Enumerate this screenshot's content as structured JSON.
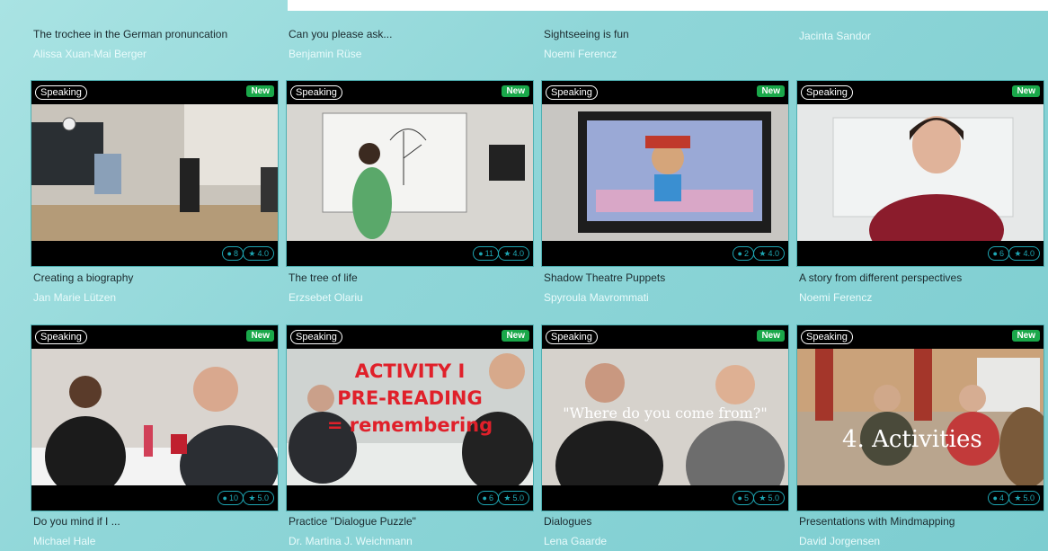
{
  "top_row": [
    {
      "title": "The trochee in the German pronuncation",
      "author": "Alissa Xuan-Mai Berger"
    },
    {
      "title": "Can you please ask...",
      "author": "Benjamin Rüse"
    },
    {
      "title": "Sightseeing is fun",
      "author": "Noemi Ferencz"
    },
    {
      "title": "",
      "author": "Jacinta Sandor"
    }
  ],
  "row1": [
    {
      "tag": "Speaking",
      "badge": "New",
      "comments": "8",
      "rating": "4.0",
      "title": "Creating a biography",
      "author": "Jan Marie Lützen"
    },
    {
      "tag": "Speaking",
      "badge": "New",
      "comments": "11",
      "rating": "4.0",
      "title": "The tree of life",
      "author": "Erzsebet Olariu"
    },
    {
      "tag": "Speaking",
      "badge": "New",
      "comments": "2",
      "rating": "4.0",
      "title": "Shadow Theatre Puppets",
      "author": "Spyroula Mavrommati"
    },
    {
      "tag": "Speaking",
      "badge": "New",
      "comments": "6",
      "rating": "4.0",
      "title": "A story from different perspectives",
      "author": "Noemi Ferencz"
    }
  ],
  "row2": [
    {
      "tag": "Speaking",
      "badge": "New",
      "comments": "10",
      "rating": "5.0",
      "title": "Do you mind if I ...",
      "author": "Michael Hale"
    },
    {
      "tag": "Speaking",
      "badge": "New",
      "comments": "6",
      "rating": "5.0",
      "title": "Practice \"Dialogue Puzzle\"",
      "author": "Dr. Martina J. Weichmann",
      "overlay": [
        "ACTIVITY I",
        "PRE-READING",
        "= remembering"
      ]
    },
    {
      "tag": "Speaking",
      "badge": "New",
      "comments": "5",
      "rating": "5.0",
      "title": "Dialogues",
      "author": "Lena Gaarde",
      "overlay": "\"Where do you come from?\""
    },
    {
      "tag": "Speaking",
      "badge": "New",
      "comments": "4",
      "rating": "5.0",
      "title": "Presentations with Mindmapping",
      "author": "David Jorgensen",
      "overlay": "4. Activities"
    }
  ],
  "icons": {
    "comment": "comment-icon",
    "star": "star-icon"
  },
  "colors": {
    "badge_green": "#1aa84a",
    "stat_teal": "#1ea6b3"
  }
}
